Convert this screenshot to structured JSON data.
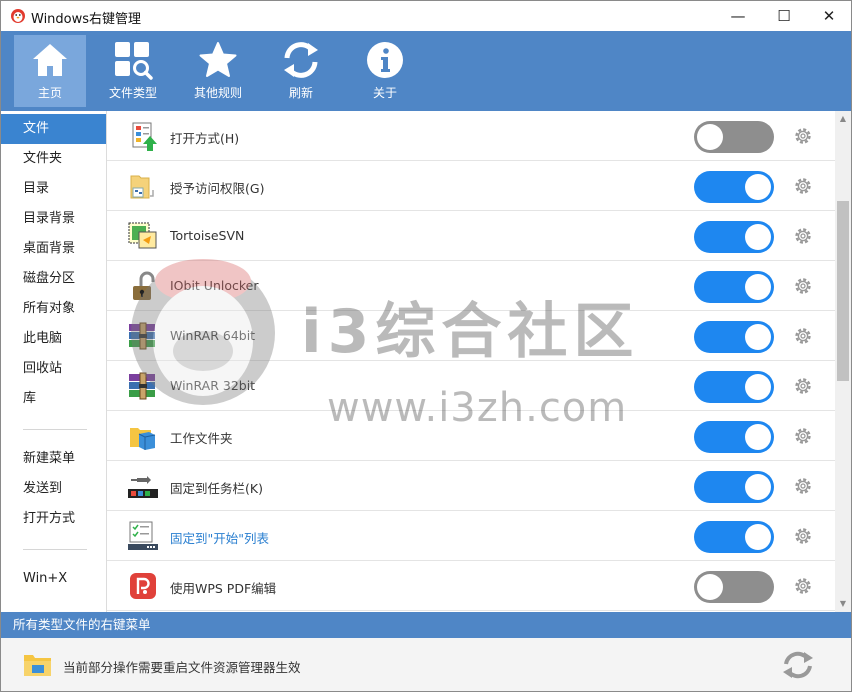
{
  "window": {
    "title": "Windows右键管理",
    "minimize": "—",
    "maximize": "☐",
    "close": "✕"
  },
  "toolbar": {
    "items": [
      {
        "label": "主页",
        "icon": "home-icon"
      },
      {
        "label": "文件类型",
        "icon": "file-type-search-icon"
      },
      {
        "label": "其他规则",
        "icon": "star-icon"
      },
      {
        "label": "刷新",
        "icon": "refresh-icon"
      },
      {
        "label": "关于",
        "icon": "info-icon"
      }
    ]
  },
  "sidebar": {
    "items": [
      {
        "label": "文件"
      },
      {
        "label": "文件夹"
      },
      {
        "label": "目录"
      },
      {
        "label": "目录背景"
      },
      {
        "label": "桌面背景"
      },
      {
        "label": "磁盘分区"
      },
      {
        "label": "所有对象"
      },
      {
        "label": "此电脑"
      },
      {
        "label": "回收站"
      },
      {
        "label": "库"
      },
      {
        "label": "新建菜单"
      },
      {
        "label": "发送到"
      },
      {
        "label": "打开方式"
      },
      {
        "label": "Win+X"
      }
    ]
  },
  "list": {
    "rows": [
      {
        "label": "打开方式(H)",
        "enabled": false,
        "icon": "open-with-icon"
      },
      {
        "label": "授予访问权限(G)",
        "enabled": true,
        "icon": "grant-access-icon"
      },
      {
        "label": "TortoiseSVN",
        "enabled": true,
        "icon": "tortoisesvn-icon"
      },
      {
        "label": "IObit Unlocker",
        "enabled": true,
        "icon": "unlocker-icon"
      },
      {
        "label": "WinRAR 64bit",
        "enabled": true,
        "icon": "winrar-icon"
      },
      {
        "label": "WinRAR 32bit",
        "enabled": true,
        "icon": "winrar-icon"
      },
      {
        "label": "工作文件夹",
        "enabled": true,
        "icon": "work-folder-icon"
      },
      {
        "label": "固定到任务栏(K)",
        "enabled": true,
        "icon": "pin-taskbar-icon"
      },
      {
        "label": "固定到\"开始\"列表",
        "enabled": true,
        "icon": "pin-start-icon"
      },
      {
        "label": "使用WPS PDF编辑",
        "enabled": false,
        "icon": "wps-pdf-icon"
      }
    ]
  },
  "status": {
    "text": "所有类型文件的右键菜单"
  },
  "footer": {
    "text": "当前部分操作需要重启文件资源管理器生效"
  },
  "watermark": {
    "text": "i3综合社区",
    "url": "www.i3zh.com"
  },
  "colors": {
    "accent": "#4f86c6",
    "toggle_on": "#1e87f0",
    "toggle_off": "#8e8e8e",
    "sidebar_active": "#3a84d0"
  }
}
